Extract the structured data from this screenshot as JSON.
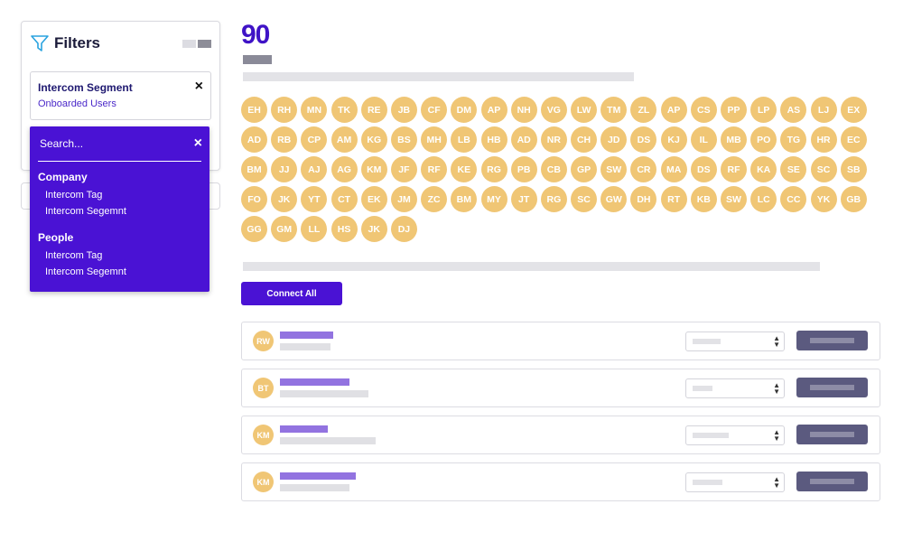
{
  "filters": {
    "title": "Filters",
    "segment": {
      "label": "Intercom Segment",
      "value": "Onboarded Users",
      "close_icon": "×"
    }
  },
  "dropdown": {
    "search_placeholder": "Search...",
    "close_icon": "×",
    "groups": [
      {
        "label": "Company",
        "items": [
          "Intercom Tag",
          "Intercom Segemnt"
        ]
      },
      {
        "label": "People",
        "items": [
          "Intercom Tag",
          "Intercom Segemnt"
        ]
      }
    ]
  },
  "summary": {
    "count": "90"
  },
  "avatars": [
    "EH",
    "RH",
    "MN",
    "TK",
    "RE",
    "JB",
    "CF",
    "DM",
    "AP",
    "NH",
    "VG",
    "LW",
    "TM",
    "ZL",
    "AP",
    "CS",
    "PP",
    "LP",
    "AS",
    "LJ",
    "EX",
    "AD",
    "RB",
    "CP",
    "AM",
    "KG",
    "BS",
    "MH",
    "LB",
    "HB",
    "AD",
    "NR",
    "CH",
    "JD",
    "DS",
    "KJ",
    "IL",
    "MB",
    "PO",
    "TG",
    "HR",
    "EC",
    "BM",
    "JJ",
    "AJ",
    "AG",
    "KM",
    "JF",
    "RF",
    "KE",
    "RG",
    "PB",
    "CB",
    "GP",
    "SW",
    "CR",
    "MA",
    "DS",
    "RF",
    "KA",
    "SE",
    "SC",
    "SB",
    "FO",
    "JK",
    "YT",
    "CT",
    "EK",
    "JM",
    "ZC",
    "BM",
    "MY",
    "JT",
    "RG",
    "SC",
    "GW",
    "DH",
    "RT",
    "KB",
    "SW",
    "LC",
    "CC",
    "YK",
    "GB",
    "GG",
    "GM",
    "LL",
    "HS",
    "JK",
    "DJ"
  ],
  "connect_all_label": "Connect All",
  "rows": [
    {
      "initials": "RW"
    },
    {
      "initials": "BT"
    },
    {
      "initials": "KM"
    },
    {
      "initials": "KM"
    }
  ],
  "colors": {
    "accent": "#4a12d4",
    "avatar": "#f0c675",
    "action": "#5b5a7f"
  },
  "icons": [
    "filter-icon",
    "close-icon",
    "select-arrows-icon"
  ]
}
